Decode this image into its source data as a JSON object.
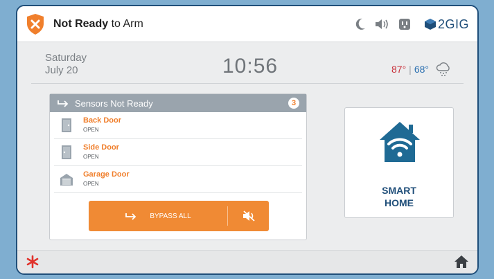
{
  "header": {
    "status_bold": "Not Ready",
    "status_rest": " to Arm",
    "icons": [
      "night-mode-icon",
      "volume-icon",
      "outlet-icon"
    ],
    "brand": "2GIG",
    "alert_color": "#f07f2c"
  },
  "datetime": {
    "day": "Saturday",
    "date": "July 20",
    "time": "10:56"
  },
  "weather": {
    "high": "87°",
    "separator": "|",
    "low": "68°",
    "icon": "snow-cloud-icon"
  },
  "sensors": {
    "title": "Sensors Not Ready",
    "count": "3",
    "items": [
      {
        "name": "Back Door",
        "state": "OPEN",
        "icon": "door-icon"
      },
      {
        "name": "Side Door",
        "state": "OPEN",
        "icon": "door-icon"
      },
      {
        "name": "Garage Door",
        "state": "OPEN",
        "icon": "garage-icon"
      }
    ],
    "bypass_label": "BYPASS ALL"
  },
  "smart_home": {
    "line1": "SMART",
    "line2": "HOME"
  },
  "footer": {
    "left_icon": "emergency-asterisk-icon",
    "right_icon": "home-icon"
  }
}
